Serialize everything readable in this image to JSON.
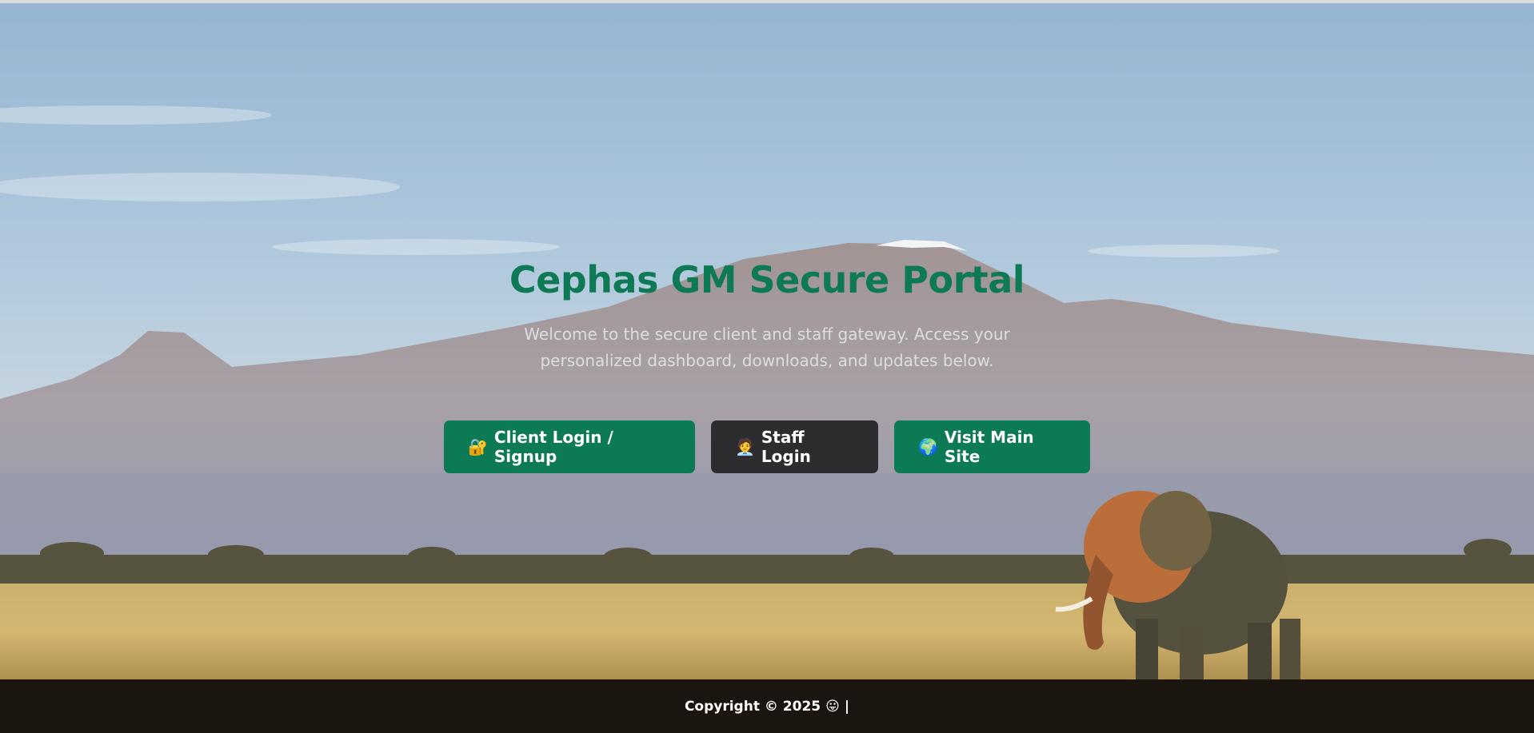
{
  "hero": {
    "title": "Cephas GM Secure Portal",
    "subtitle": "Welcome to the secure client and staff gateway. Access your personalized dashboard, downloads, and updates below."
  },
  "actions": {
    "client": {
      "icon": "lock-icon",
      "glyph": "🔐",
      "label": "Client Login / Signup"
    },
    "staff": {
      "icon": "staff-person-icon",
      "glyph": "🧑‍💼",
      "label": "Staff Login"
    },
    "site": {
      "icon": "globe-icon",
      "glyph": "🌍",
      "label": "Visit Main Site"
    }
  },
  "footer": {
    "copyright": "Copyright © 2025",
    "emoji": "😛",
    "separator": "|"
  },
  "colors": {
    "brand_green": "#0d7a56",
    "dark_button": "#2d2d2f",
    "footer_bg": "#1b150f"
  }
}
